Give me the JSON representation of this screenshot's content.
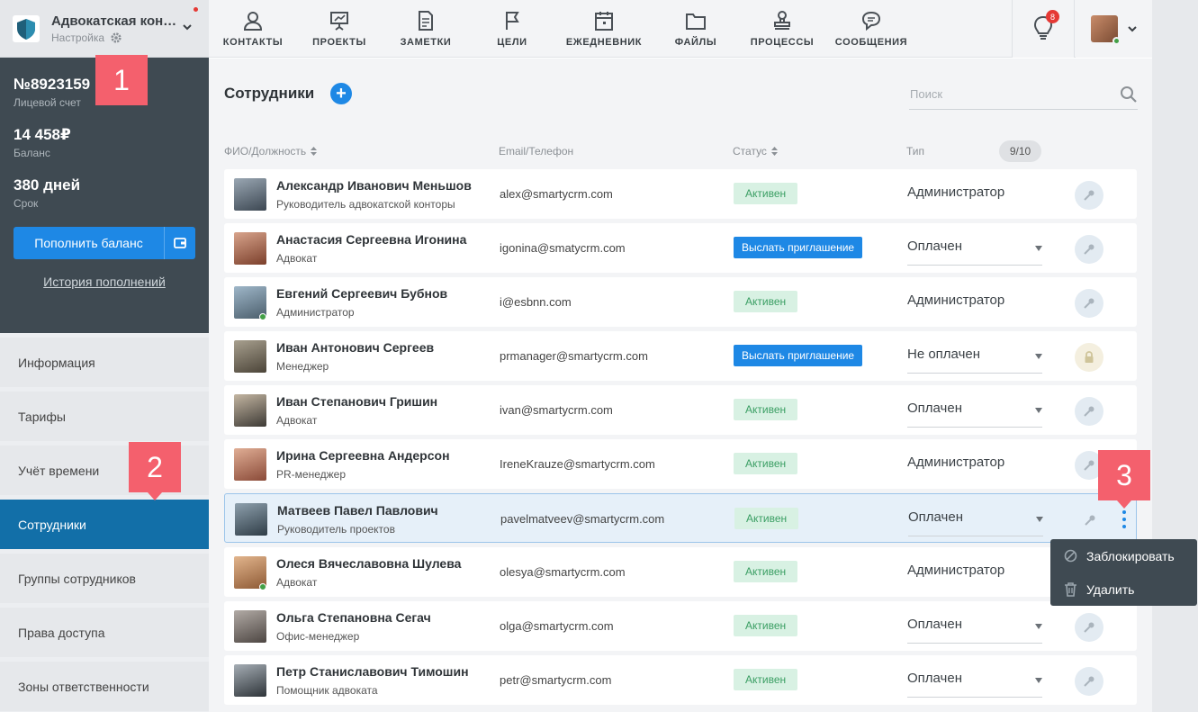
{
  "company": {
    "name": "Адвокатская кон…",
    "subtitle": "Настройка"
  },
  "account": {
    "number": "№8923159",
    "number_label": "Лицевой счет",
    "balance": "14 458₽",
    "balance_label": "Баланс",
    "term": "380 дней",
    "term_label": "Срок",
    "topup_label": "Пополнить баланс",
    "history_label": "История пополнений"
  },
  "sidebar": {
    "items": [
      {
        "label": "Информация"
      },
      {
        "label": "Тарифы"
      },
      {
        "label": "Учёт времени"
      },
      {
        "label": "Сотрудники"
      },
      {
        "label": "Группы сотрудников"
      },
      {
        "label": "Права доступа"
      },
      {
        "label": "Зоны ответственности"
      }
    ],
    "active_index": 3
  },
  "nav": {
    "items": [
      {
        "label": "КОНТАКТЫ",
        "icon": "person-icon"
      },
      {
        "label": "ПРОЕКТЫ",
        "icon": "presentation-icon"
      },
      {
        "label": "ЗАМЕТКИ",
        "icon": "note-icon"
      },
      {
        "label": "ЦЕЛИ",
        "icon": "flag-icon"
      },
      {
        "label": "ЕЖЕДНЕВНИК",
        "icon": "calendar-icon"
      },
      {
        "label": "ФАЙЛЫ",
        "icon": "folder-icon"
      },
      {
        "label": "ПРОЦЕССЫ",
        "icon": "stamp-icon"
      },
      {
        "label": "СООБЩЕНИЯ",
        "icon": "chat-icon"
      }
    ],
    "notifications_count": "8"
  },
  "main": {
    "title": "Сотрудники",
    "search_placeholder": "Поиск",
    "headers": {
      "name": "ФИО/Должность",
      "contact": "Email/Телефон",
      "status": "Статус",
      "type": "Тип"
    },
    "counter": "9/10"
  },
  "employees": [
    {
      "name": "Александр Иванович Меньшов",
      "role": "Руководитель адвокатской конторы",
      "email": "alex@smartycrm.com",
      "status": "Активен",
      "type": "Администратор"
    },
    {
      "name": "Анастасия Сергеевна Игонина",
      "role": "Адвокат",
      "email": "igonina@smatycrm.com",
      "status": "Выслать приглашение",
      "type": "Оплачен"
    },
    {
      "name": "Евгений Сергеевич Бубнов",
      "role": "Администратор",
      "email": "i@esbnn.com",
      "status": "Активен",
      "type": "Администратор"
    },
    {
      "name": "Иван Антонович Сергеев",
      "role": "Менеджер",
      "email": "prmanager@smartycrm.com",
      "status": "Выслать приглашение",
      "type": "Не оплачен"
    },
    {
      "name": "Иван Степанович Гришин",
      "role": "Адвокат",
      "email": "ivan@smartycrm.com",
      "status": "Активен",
      "type": "Оплачен"
    },
    {
      "name": "Ирина Сергеевна Андерсон",
      "role": "PR-менеджер",
      "email": "IreneKrauze@smartycrm.com",
      "status": "Активен",
      "type": "Администратор"
    },
    {
      "name": "Матвеев Павел Павлович",
      "role": "Руководитель проектов",
      "email": "pavelmatveev@smartycrm.com",
      "status": "Активен",
      "type": "Оплачен"
    },
    {
      "name": "Олеся Вячеславовна Шулева",
      "role": "Адвокат",
      "email": "olesya@smartycrm.com",
      "status": "Активен",
      "type": "Администратор"
    },
    {
      "name": "Ольга Степановна Сегач",
      "role": "Офис-менеджер",
      "email": "olga@smartycrm.com",
      "status": "Активен",
      "type": "Оплачен"
    },
    {
      "name": "Петр Станиславович Тимошин",
      "role": "Помощник адвоката",
      "email": "petr@smartycrm.com",
      "status": "Активен",
      "type": "Оплачен"
    }
  ],
  "menu": {
    "block": "Заблокировать",
    "delete": "Удалить"
  },
  "callouts": [
    "1",
    "2",
    "3"
  ]
}
